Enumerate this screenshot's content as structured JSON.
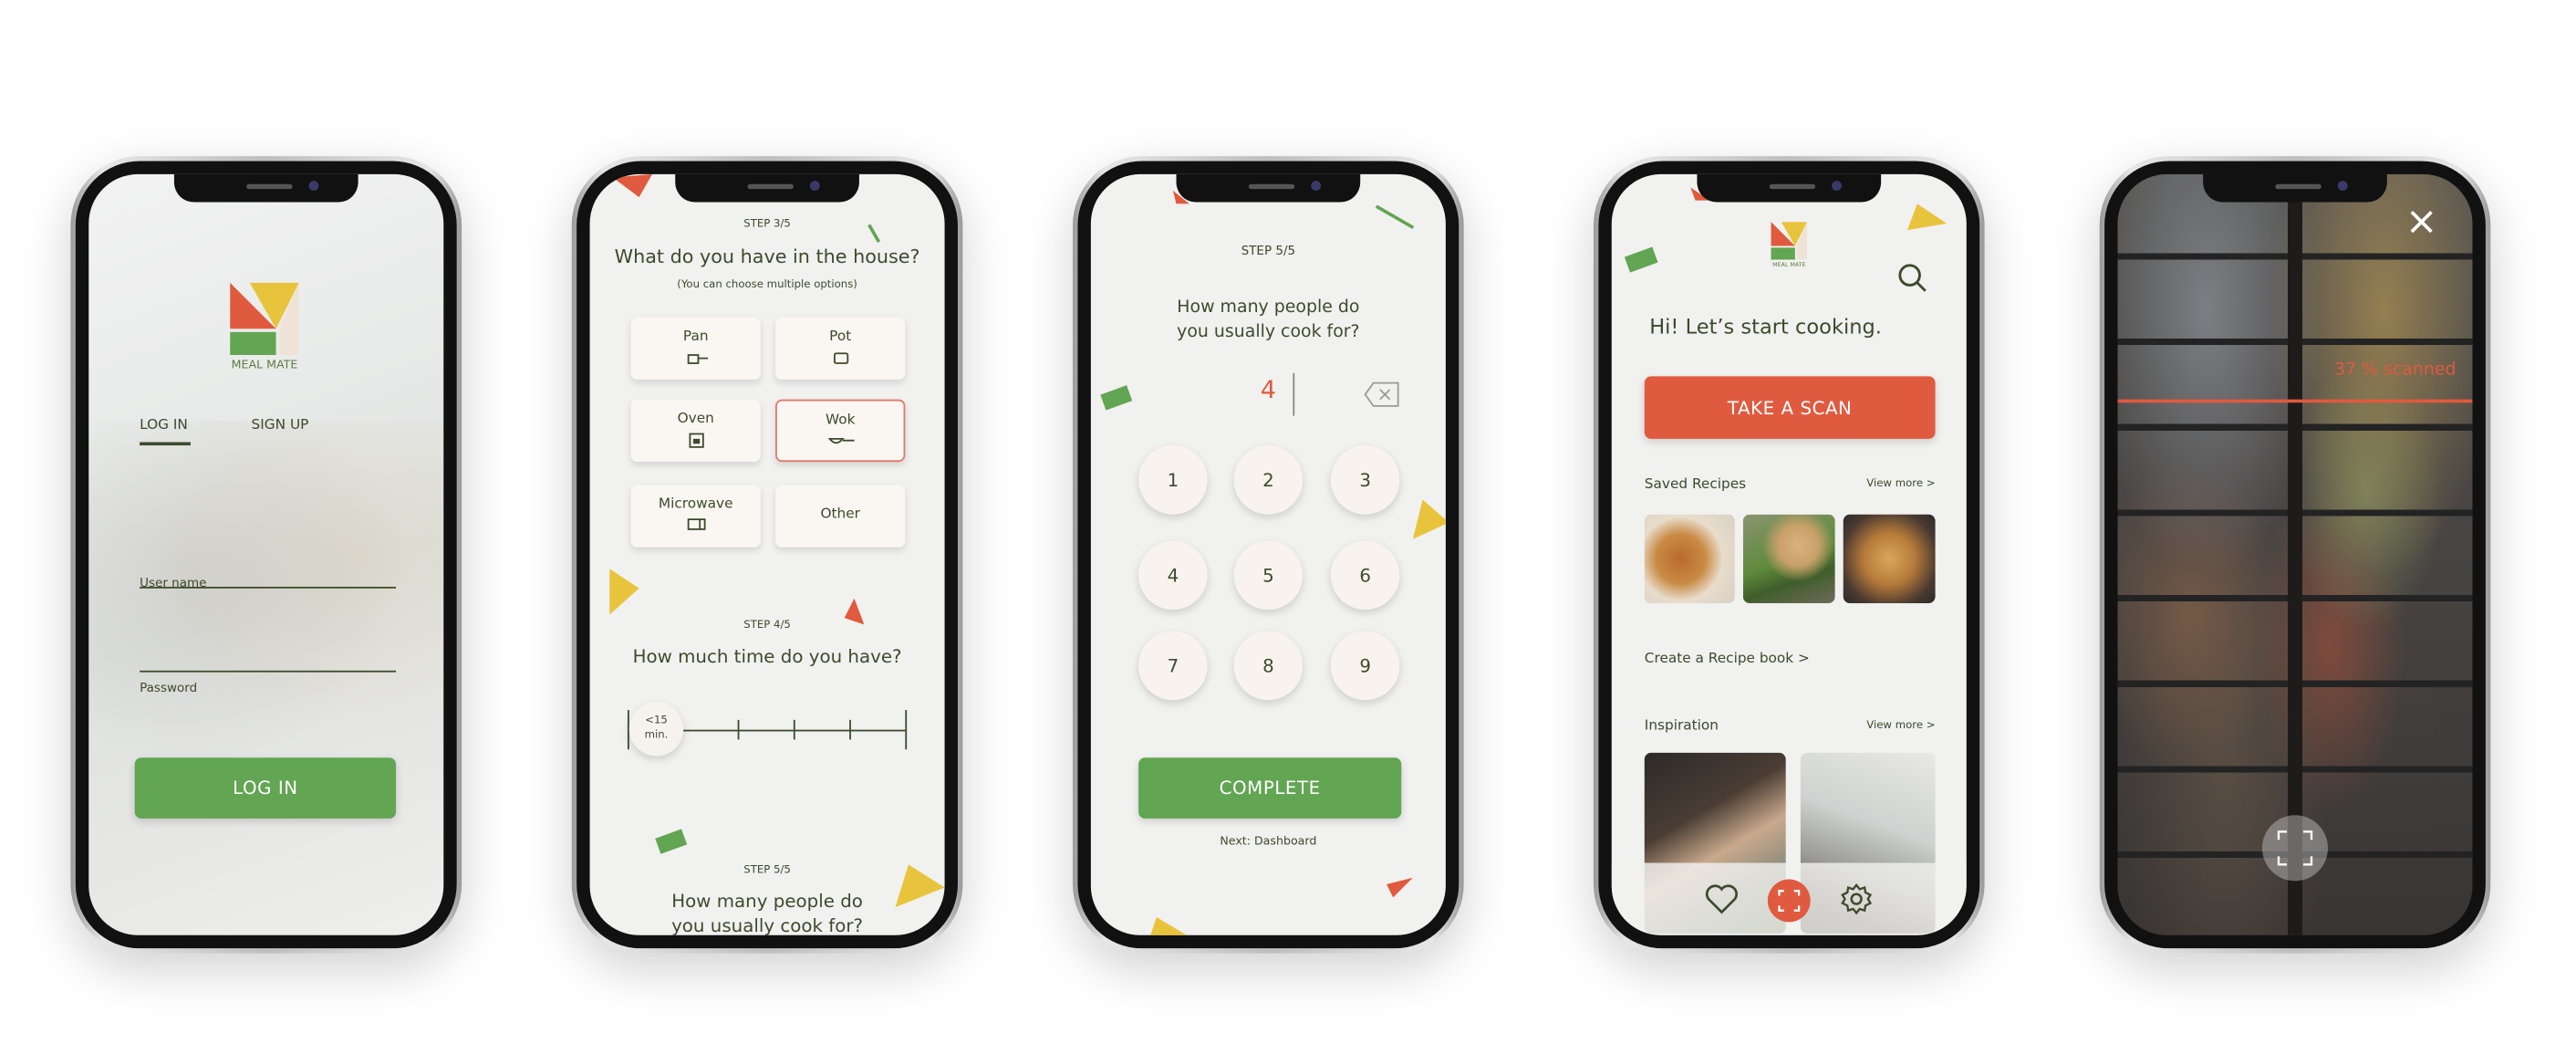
{
  "colors": {
    "green": "#62a552",
    "red": "#e05a3f",
    "yellow": "#e8c43c",
    "text": "#3d4a2c"
  },
  "login": {
    "logo_text": "MEAL MATE",
    "tabs": [
      {
        "label": "LOG IN",
        "active": true
      },
      {
        "label": "SIGN UP",
        "active": false
      }
    ],
    "username_label": "User name",
    "password_label": "Password",
    "button": "LOG IN"
  },
  "setup": {
    "step3": "STEP 3/5",
    "question3": "What do you have in the house?",
    "hint3": "(You can choose multiple options)",
    "options": [
      {
        "label": "Pan",
        "icon": "pan-icon",
        "selected": false
      },
      {
        "label": "Pot",
        "icon": "pot-icon",
        "selected": false
      },
      {
        "label": "Oven",
        "icon": "oven-icon",
        "selected": false
      },
      {
        "label": "Wok",
        "icon": "wok-icon",
        "selected": true
      },
      {
        "label": "Microwave",
        "icon": "microwave-icon",
        "selected": false
      },
      {
        "label": "Other",
        "icon": "",
        "selected": false
      }
    ],
    "step4": "STEP 4/5",
    "question4": "How much time do you have?",
    "slider_value": "<15",
    "slider_unit": "min.",
    "step5": "STEP 5/5",
    "question5_line1": "How many people do",
    "question5_line2": "you usually cook for?"
  },
  "people": {
    "step": "STEP 5/5",
    "question_line1": "How many people do",
    "question_line2": "you usually cook for?",
    "value": "4",
    "keys": [
      "1",
      "2",
      "3",
      "4",
      "5",
      "6",
      "7",
      "8",
      "9"
    ],
    "complete": "COMPLETE",
    "next": "Next: Dashboard"
  },
  "dashboard": {
    "logo_text": "MEAL MATE",
    "greeting": "Hi! Let’s start cooking.",
    "scan_button": "TAKE A SCAN",
    "saved_title": "Saved Recipes",
    "saved_more": "View more >",
    "recipe_book": "Create a Recipe book  >",
    "inspiration_title": "Inspiration",
    "inspiration_more": "View more >"
  },
  "scan": {
    "progress_text": "37 % scanned",
    "progress_percent": 37
  }
}
